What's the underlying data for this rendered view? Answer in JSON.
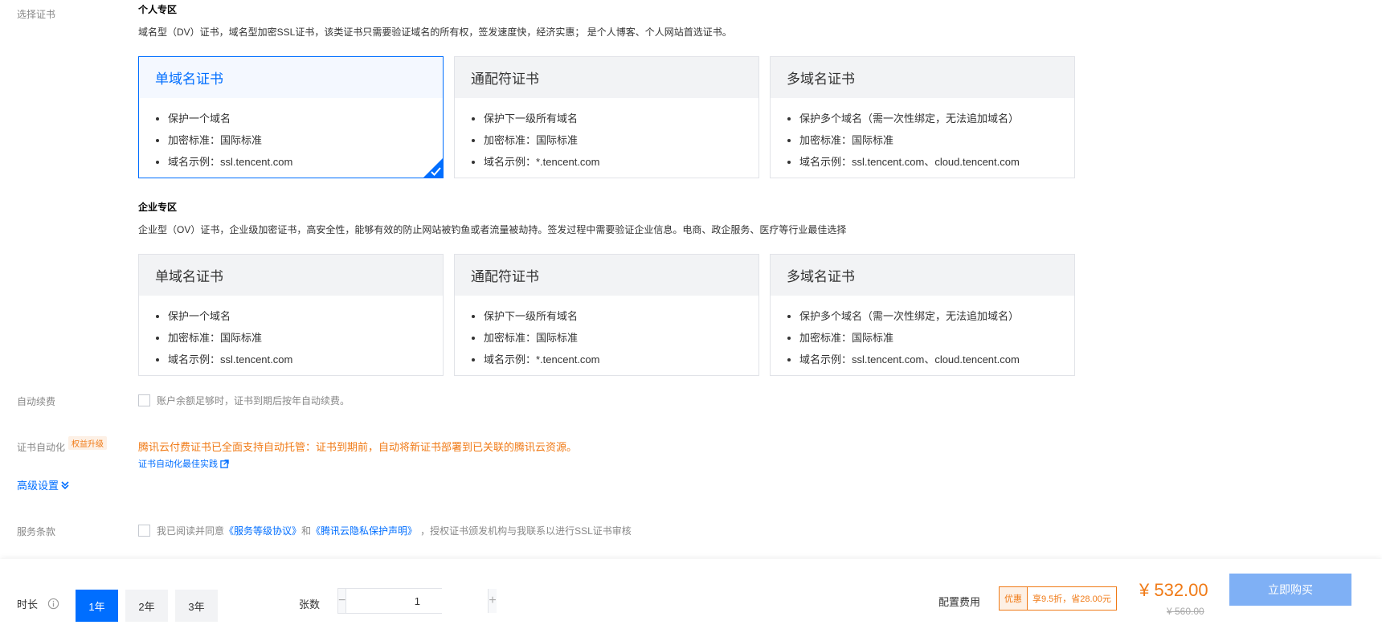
{
  "select_cert": {
    "label": "选择证书",
    "personal": {
      "title": "个人专区",
      "desc": "域名型（DV）证书，域名型加密SSL证书，该类证书只需要验证域名的所有权，签发速度快，经济实惠； 是个人博客、个人网站首选证书。",
      "cards": [
        {
          "title": "单域名证书",
          "items": [
            "保护一个域名",
            "加密标准：国际标准",
            "域名示例：ssl.tencent.com"
          ],
          "selected": true
        },
        {
          "title": "通配符证书",
          "items": [
            "保护下一级所有域名",
            "加密标准：国际标准",
            "域名示例：*.tencent.com"
          ],
          "selected": false
        },
        {
          "title": "多域名证书",
          "items": [
            "保护多个域名（需一次性绑定，无法追加域名）",
            "加密标准：国际标准",
            "域名示例：ssl.tencent.com、cloud.tencent.com"
          ],
          "selected": false
        }
      ]
    },
    "enterprise": {
      "title": "企业专区",
      "desc": "企业型（OV）证书，企业级加密证书，高安全性，能够有效的防止网站被钓鱼或者流量被劫持。签发过程中需要验证企业信息。电商、政企服务、医疗等行业最佳选择",
      "cards": [
        {
          "title": "单域名证书",
          "items": [
            "保护一个域名",
            "加密标准：国际标准",
            "域名示例：ssl.tencent.com"
          ],
          "selected": false
        },
        {
          "title": "通配符证书",
          "items": [
            "保护下一级所有域名",
            "加密标准：国际标准",
            "域名示例：*.tencent.com"
          ],
          "selected": false
        },
        {
          "title": "多域名证书",
          "items": [
            "保护多个域名（需一次性绑定，无法追加域名）",
            "加密标准：国际标准",
            "域名示例：ssl.tencent.com、cloud.tencent.com"
          ],
          "selected": false
        }
      ]
    }
  },
  "auto_renew": {
    "label": "自动续费",
    "text": "账户余额足够时，证书到期后按年自动续费。"
  },
  "automation": {
    "label": "证书自动化",
    "badge": "权益升级",
    "text": "腾讯云付费证书已全面支持自动托管：证书到期前，自动将新证书部署到已关联的腾讯云资源。",
    "link": "证书自动化最佳实践"
  },
  "advanced": {
    "label": "高级设置"
  },
  "terms": {
    "label": "服务条款",
    "prefix": "我已阅读并同意",
    "link1": "《服务等级协议》",
    "and": "和",
    "link2": "《腾讯云隐私保护声明》",
    "suffix": "，授权证书颁发机构与我联系以进行SSL证书审核"
  },
  "bottom": {
    "duration_label": "时长",
    "durations": [
      "1年",
      "2年",
      "3年"
    ],
    "active_duration": 0,
    "qty_label": "张数",
    "qty_minus": "−",
    "qty_plus": "+",
    "qty_value": "1",
    "fee_label": "配置费用",
    "promo_tag": "优惠",
    "promo_text": "享9.5折，省28.00元",
    "price": "¥ 532.00",
    "old_price": "¥ 560.00",
    "buy_label": "立即购买"
  },
  "colors": {
    "accent": "#006eff",
    "warning": "#f07a16"
  }
}
